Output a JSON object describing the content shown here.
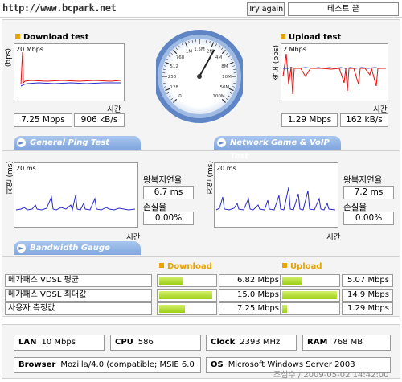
{
  "header": {
    "url": "http://www.bcpark.net",
    "try_again": "Try again",
    "test_end": "테스트 끝"
  },
  "download": {
    "title": "Download test",
    "ylabel": "(bps)",
    "ymax": "20 Mbps",
    "xlabel": "시간",
    "mbps": "7.25 Mbps",
    "kbs": "906 kB/s"
  },
  "upload": {
    "title": "Upload test",
    "ylabel": "속도 (bps)",
    "ymax": "2 Mbps",
    "xlabel": "시간",
    "mbps": "1.29 Mbps",
    "kbs": "162 kB/s"
  },
  "gauge": {
    "ticks": [
      "0",
      "128",
      "256",
      "512",
      "768",
      "1M",
      "1.5M",
      "2M",
      "4M",
      "8M",
      "10M",
      "50M",
      "100M"
    ],
    "needle_value": "2M"
  },
  "ping": {
    "section_title": "General Ping Test",
    "ylabel": "지연 (ms)",
    "ymax": "20 ms",
    "xlabel": "시간",
    "rtt_label": "왕복지연율",
    "rtt_value": "6.7 ms",
    "loss_label": "손실율",
    "loss_value": "0.00%"
  },
  "game": {
    "section_title": "Network Game & VoIP Test",
    "ylabel": "지연 (ms)",
    "ymax": "20 ms",
    "xlabel": "시간",
    "rtt_label": "왕복지연율",
    "rtt_value": "7.2 ms",
    "loss_label": "손실율",
    "loss_value": "0.00%"
  },
  "bandwidth": {
    "section_title": "Bandwidth Gauge",
    "download_header": "Download",
    "upload_header": "Upload",
    "rows": [
      {
        "label": "메가패스 VDSL 평균",
        "down": "6.82 Mbps",
        "down_frac": 0.42,
        "up": "5.07 Mbps",
        "up_frac": 0.34
      },
      {
        "label": "메가패스 VDSL 최대값",
        "down": "15.0 Mbps",
        "down_frac": 0.93,
        "up": "14.9 Mbps",
        "up_frac": 0.96
      },
      {
        "label": "사용자 측정값",
        "down": "7.25 Mbps",
        "down_frac": 0.45,
        "up": "1.29 Mbps",
        "up_frac": 0.09
      }
    ]
  },
  "system": {
    "lan_label": "LAN",
    "lan_value": "10 Mbps",
    "cpu_label": "CPU",
    "cpu_value": "586",
    "clock_label": "Clock",
    "clock_value": "2393 MHz",
    "ram_label": "RAM",
    "ram_value": "768 MB",
    "browser_label": "Browser",
    "browser_value": "Mozilla/4.0 (compatible; MSIE 6.0",
    "os_label": "OS",
    "os_value": "Microsoft Windows Server 2003"
  },
  "footer": "조심수 / 2009-05-02 14:42:00",
  "colors": {
    "accent": "#e8a400",
    "download_line": "#2a2acc",
    "upload_line": "#dd1111",
    "bar_fill": "#9ccf17",
    "pill": "#86aae0"
  }
}
